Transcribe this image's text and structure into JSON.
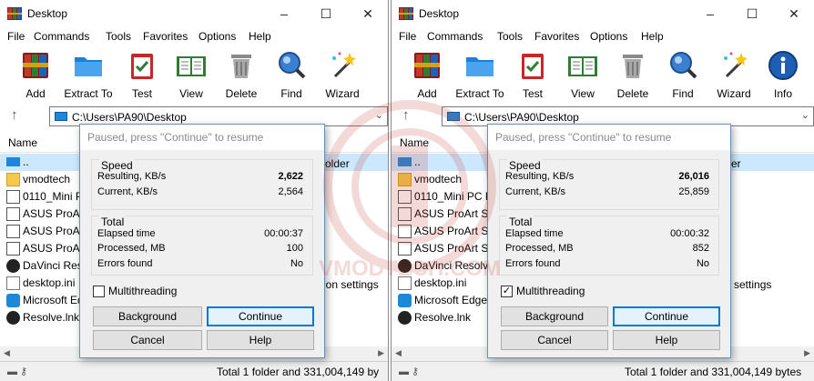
{
  "colors": {
    "selection": "#cce8ff",
    "accent": "#0078d7",
    "dialog_bg": "#f0f0f0"
  },
  "left": {
    "title": "Desktop",
    "menu": [
      "File",
      "Commands",
      "Tools",
      "Favorites",
      "Options",
      "Help"
    ],
    "tools": [
      {
        "label": "Add",
        "icon": "add-archive-icon"
      },
      {
        "label": "Extract To",
        "icon": "extract-folder-icon"
      },
      {
        "label": "Test",
        "icon": "test-clipboard-icon"
      },
      {
        "label": "View",
        "icon": "view-book-icon"
      },
      {
        "label": "Delete",
        "icon": "trash-icon"
      },
      {
        "label": "Find",
        "icon": "magnifier-icon"
      },
      {
        "label": "Wizard",
        "icon": "magic-wand-icon"
      }
    ],
    "path": "C:\\Users\\PA90\\Desktop",
    "column_name": "Name",
    "files": [
      "..",
      "vmodtech",
      "0110_Mini P",
      "ASUS ProAr",
      "ASUS ProAr",
      "ASUS ProAr",
      "DaVinci Reso",
      "desktop.ini",
      "Microsoft Ed",
      "Resolve.lnk"
    ],
    "behind_text": [
      "older",
      "ation settings"
    ],
    "status": "Total 1 folder and 331,004,149 by",
    "dialog": {
      "title": "Paused, press \"Continue\" to resume",
      "speed_title": "Speed",
      "resulting_label": "Resulting, KB/s",
      "resulting_value": "2,622",
      "current_label": "Current, KB/s",
      "current_value": "2,564",
      "total_title": "Total",
      "elapsed_label": "Elapsed time",
      "elapsed_value": "00:00:37",
      "processed_label": "Processed, MB",
      "processed_value": "100",
      "errors_label": "Errors found",
      "errors_value": "No",
      "multithreading_label": "Multithreading",
      "multithreading_checked": false,
      "background_label": "Background",
      "continue_label": "Continue",
      "cancel_label": "Cancel",
      "help_label": "Help"
    }
  },
  "right": {
    "title": "Desktop",
    "menu": [
      "File",
      "Commands",
      "Tools",
      "Favorites",
      "Options",
      "Help"
    ],
    "tools": [
      {
        "label": "Add",
        "icon": "add-archive-icon"
      },
      {
        "label": "Extract To",
        "icon": "extract-folder-icon"
      },
      {
        "label": "Test",
        "icon": "test-clipboard-icon"
      },
      {
        "label": "View",
        "icon": "view-book-icon"
      },
      {
        "label": "Delete",
        "icon": "trash-icon"
      },
      {
        "label": "Find",
        "icon": "magnifier-icon"
      },
      {
        "label": "Wizard",
        "icon": "magic-wand-icon"
      },
      {
        "label": "Info",
        "icon": "info-icon"
      }
    ],
    "path": "C:\\Users\\PA90\\Desktop",
    "column_name": "Name",
    "files": [
      "..",
      "vmodtech",
      "0110_Mini PC P",
      "ASUS ProArt Se",
      "ASUS ProArt Se",
      "ASUS ProArt Se",
      "DaVinci Resolv",
      "desktop.ini",
      "Microsoft Edge",
      "Resolve.lnk"
    ],
    "behind_text": [
      "er",
      "n settings"
    ],
    "status": "Total 1 folder and 331,004,149 bytes",
    "dialog": {
      "title": "Paused, press \"Continue\" to resume",
      "speed_title": "Speed",
      "resulting_label": "Resulting, KB/s",
      "resulting_value": "26,016",
      "current_label": "Current, KB/s",
      "current_value": "25,859",
      "total_title": "Total",
      "elapsed_label": "Elapsed time",
      "elapsed_value": "00:00:32",
      "processed_label": "Processed, MB",
      "processed_value": "852",
      "errors_label": "Errors found",
      "errors_value": "No",
      "multithreading_label": "Multithreading",
      "multithreading_checked": true,
      "background_label": "Background",
      "continue_label": "Continue",
      "cancel_label": "Cancel",
      "help_label": "Help"
    }
  },
  "watermark": "VMODTECH.COM"
}
